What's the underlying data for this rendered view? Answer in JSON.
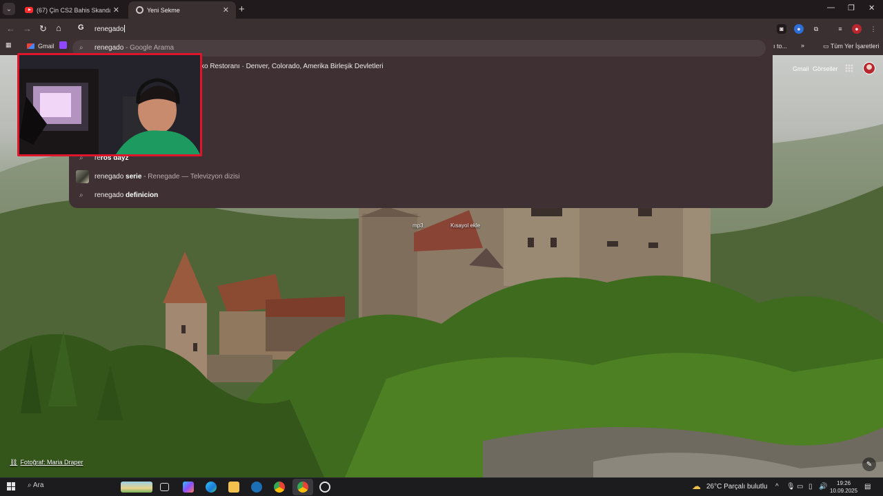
{
  "tabs": [
    {
      "title": "(67) Çin CS2 Bahis Skandalı! Ma",
      "icon": "youtube-icon",
      "active": false
    },
    {
      "title": "Yeni Sekme",
      "icon": "chrome-icon",
      "active": true
    }
  ],
  "omnibox": {
    "engine_letter": "G",
    "value": "renegado"
  },
  "bookmarks": {
    "gmail": "Gmail",
    "overflow_label": "ı to...",
    "all_bookmarks": "Tüm Yer İşaretleri"
  },
  "suggestions": [
    {
      "query": "renegado",
      "suffix": " - Google Arama",
      "type": "search"
    },
    {
      "query": "ko Restoranı · Denver, Colorado, Amerika Birleşik Devletleri",
      "suffix": "",
      "type": "place"
    },
    {
      "prefix": "re",
      "query": "ros dayz",
      "type": "search"
    },
    {
      "prefix": "renegado ",
      "bold": "serie",
      "suffix": " - Renegade — Televizyon dizisi",
      "type": "entity"
    },
    {
      "prefix": "renegado ",
      "bold": "definicion",
      "type": "search"
    }
  ],
  "ntp": {
    "gmail": "Gmail",
    "images": "Görseller",
    "shortcuts": [
      "mp3",
      "Kısayol ekle"
    ],
    "photo_credit": "Fotoğraf: Maria Draper"
  },
  "taskbar": {
    "search": "Ara",
    "weather": "26°C  Parçalı bulutlu",
    "time": "19:26",
    "date": "10.09.2025"
  },
  "colors": {
    "accent_tab": "#3a2f31",
    "dropdown": "#3f3133",
    "cam_border": "#e0142a"
  }
}
